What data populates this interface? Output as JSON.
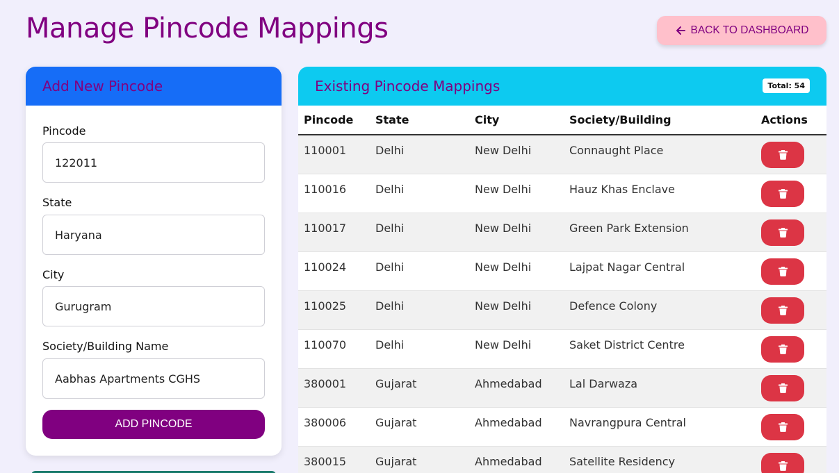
{
  "page_title": "Manage Pincode Mappings",
  "back_button": {
    "label": "BACK TO DASHBOARD",
    "icon": "arrow-left-icon"
  },
  "add_form": {
    "header": "Add New Pincode",
    "fields": [
      {
        "label": "Pincode",
        "value": "122011"
      },
      {
        "label": "State",
        "value": "Haryana"
      },
      {
        "label": "City",
        "value": "Gurugram"
      },
      {
        "label": "Society/Building Name",
        "value": "Aabhas Apartments CGHS"
      }
    ],
    "submit_label": "ADD PINCODE"
  },
  "mappings": {
    "header": "Existing Pincode Mappings",
    "total_label": "Total: 54",
    "columns": [
      "Pincode",
      "State",
      "City",
      "Society/Building",
      "Actions"
    ],
    "rows": [
      [
        "110001",
        "Delhi",
        "New Delhi",
        "Connaught Place"
      ],
      [
        "110016",
        "Delhi",
        "New Delhi",
        "Hauz Khas Enclave"
      ],
      [
        "110017",
        "Delhi",
        "New Delhi",
        "Green Park Extension"
      ],
      [
        "110024",
        "Delhi",
        "New Delhi",
        "Lajpat Nagar Central"
      ],
      [
        "110025",
        "Delhi",
        "New Delhi",
        "Defence Colony"
      ],
      [
        "110070",
        "Delhi",
        "New Delhi",
        "Saket District Centre"
      ],
      [
        "380001",
        "Gujarat",
        "Ahmedabad",
        "Lal Darwaza"
      ],
      [
        "380006",
        "Gujarat",
        "Ahmedabad",
        "Navrangpura Central"
      ],
      [
        "380015",
        "Gujarat",
        "Ahmedabad",
        "Satellite Residency"
      ]
    ],
    "delete_icon": "trash-icon"
  },
  "colors": {
    "background": "#f1effc",
    "title": "#800080",
    "back_button_bg": "#ffc0cb",
    "add_header_bg": "#166df7",
    "list_header_bg": "#0dcaf0",
    "primary_button": "#800080",
    "delete_button": "#dc3545"
  }
}
